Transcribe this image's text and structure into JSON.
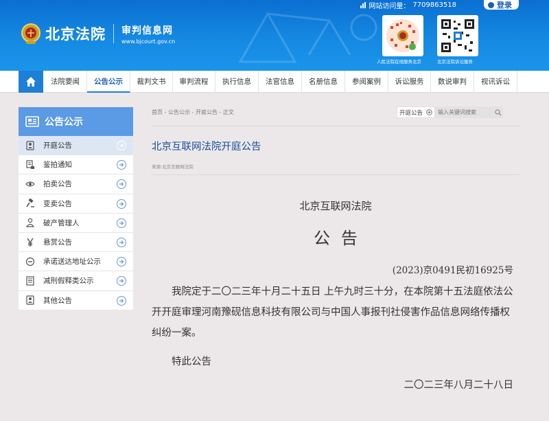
{
  "header": {
    "visits_label": "网站访问量：",
    "visits_count": "7709863518",
    "login_label": "登录",
    "logo_title": "北京法院",
    "logo_sub_title": "审判信息网",
    "logo_sub_url": "www.bjcourt.gov.cn",
    "qr_codes": [
      {
        "label": "人民法院在线服务北京"
      },
      {
        "label": "北京法院诉讼服务"
      }
    ]
  },
  "nav": {
    "items": [
      {
        "label": "法院要闻",
        "active": false
      },
      {
        "label": "公告公示",
        "active": true
      },
      {
        "label": "裁判文书",
        "active": false
      },
      {
        "label": "审判流程",
        "active": false
      },
      {
        "label": "执行信息",
        "active": false
      },
      {
        "label": "法官信息",
        "active": false
      },
      {
        "label": "名册信息",
        "active": false
      },
      {
        "label": "参阅案例",
        "active": false
      },
      {
        "label": "诉讼服务",
        "active": false
      },
      {
        "label": "数说审判",
        "active": false
      },
      {
        "label": "视讯诉讼",
        "active": false
      }
    ]
  },
  "sidebar": {
    "title": "公告公示",
    "items": [
      {
        "label": "开庭公告",
        "icon": "person-card-icon",
        "active": true
      },
      {
        "label": "鉴拍通知",
        "icon": "document-stamp-icon",
        "active": false
      },
      {
        "label": "拍卖公告",
        "icon": "eye-icon",
        "active": false
      },
      {
        "label": "变卖公告",
        "icon": "gavel-icon",
        "active": false
      },
      {
        "label": "破产管理人",
        "icon": "person-icon",
        "active": false
      },
      {
        "label": "悬赏公告",
        "icon": "yen-icon",
        "active": false
      },
      {
        "label": "承诺送达地址公示",
        "icon": "minus-circle-icon",
        "active": false
      },
      {
        "label": "减刑假释类公示",
        "icon": "list-document-icon",
        "active": false
      },
      {
        "label": "其他公告",
        "icon": "person-card-icon",
        "active": false
      }
    ]
  },
  "breadcrumb": "首页 - 公告公示 - 开庭公告 - 正文",
  "search": {
    "select_value": "开庭公告",
    "placeholder": "输入关键词搜索"
  },
  "article": {
    "title": "北京互联网法院开庭公告",
    "source": "来源:北京互联网法院",
    "court_name": "北京互联网法院",
    "notice_heading": "公告",
    "case_number": "(2023)京0491民初16925号",
    "body": "我院定于二〇二三年十月二十五日 上午九时三十分，在本院第十五法庭依法公开开庭审理河南豫砚信息科技有限公司与中国人事报刊社侵害作品信息网络传播权纠纷一案。",
    "closing": "特此公告",
    "date": "二〇二三年八月二十八日"
  }
}
